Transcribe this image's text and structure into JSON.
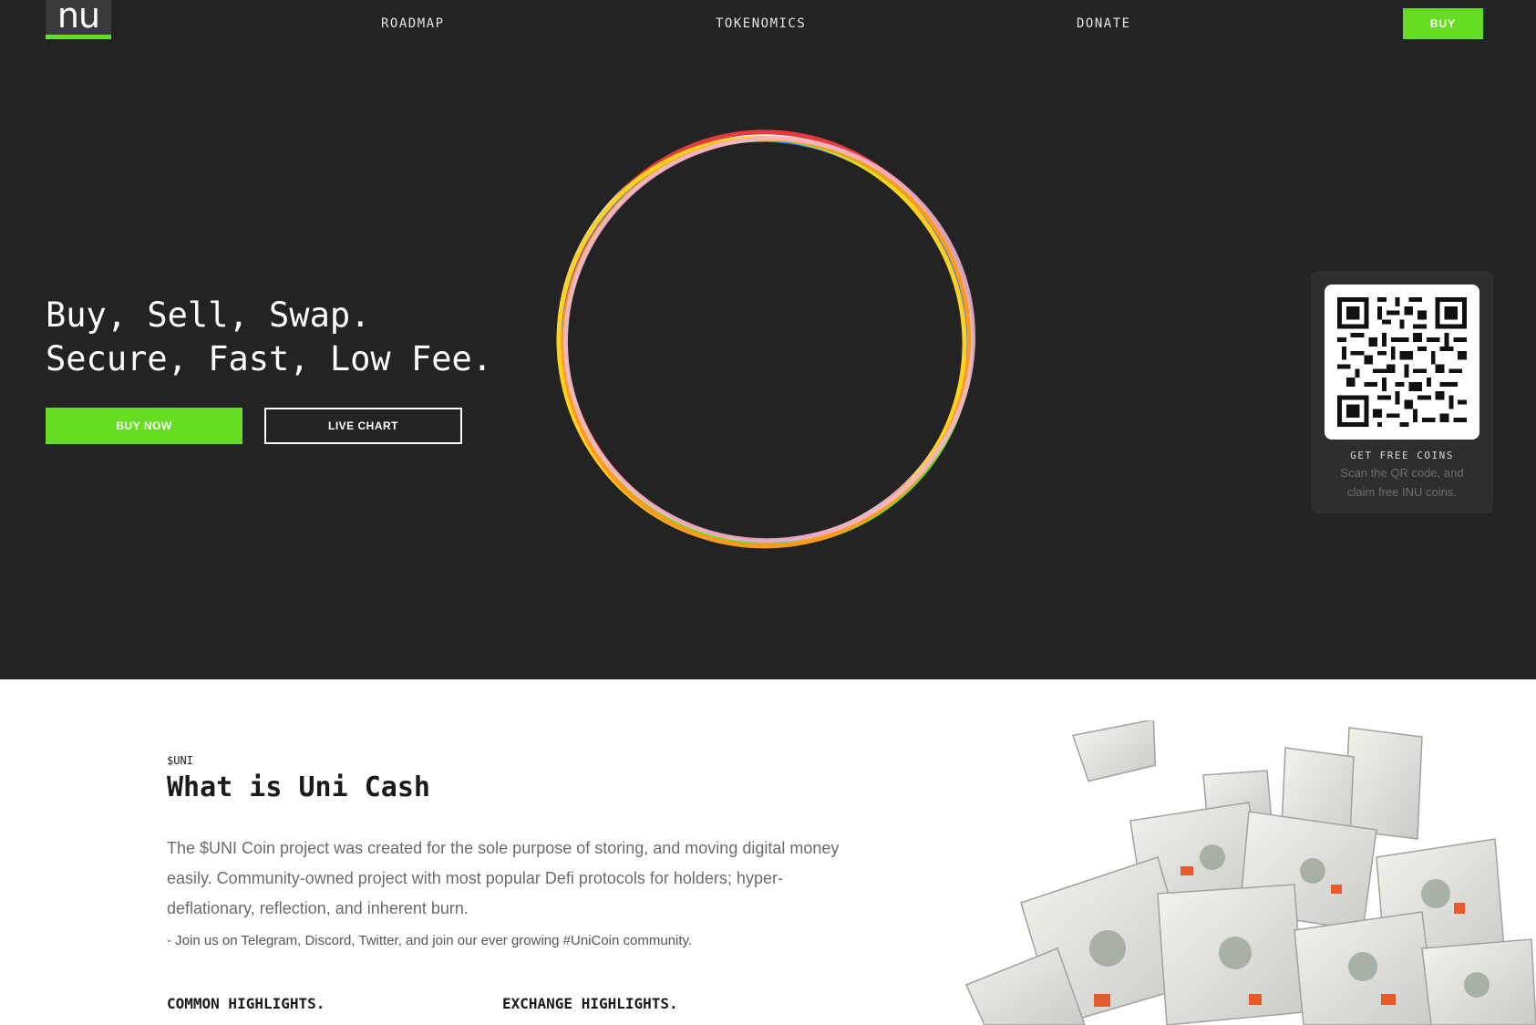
{
  "nav": {
    "logo_text": "nu",
    "links": [
      "ROADMAP",
      "TOKENOMICS",
      "DONATE"
    ],
    "buy_label": "BUY"
  },
  "hero": {
    "headline_line1": "Buy, Sell, Swap.",
    "headline_line2": "Secure, Fast, Low Fee.",
    "buy_now_label": "BUY NOW",
    "live_chart_label": "LIVE CHART"
  },
  "qr": {
    "title": "GET FREE COINS",
    "description": "Scan the QR code, and claim free INU coins."
  },
  "about": {
    "tag": "$UNI",
    "title": "What is Uni Cash",
    "paragraph": "The $UNI Coin project was created for the sole purpose of storing, and moving digital money easily. Community-owned project with most popular Defi protocols for holders; hyper-deflationary, reflection, and inherent burn.",
    "bullet": "-  Join us on Telegram, Discord, Twitter, and join our ever growing #UniCoin community.",
    "highlight_left": "COMMON HIGHLIGHTS.",
    "highlight_right": "EXCHANGE HIGHLIGHTS."
  },
  "colors": {
    "hero_background": "#232323",
    "accent_green": "#66dd22",
    "qr_card": "#2e2e2e"
  }
}
